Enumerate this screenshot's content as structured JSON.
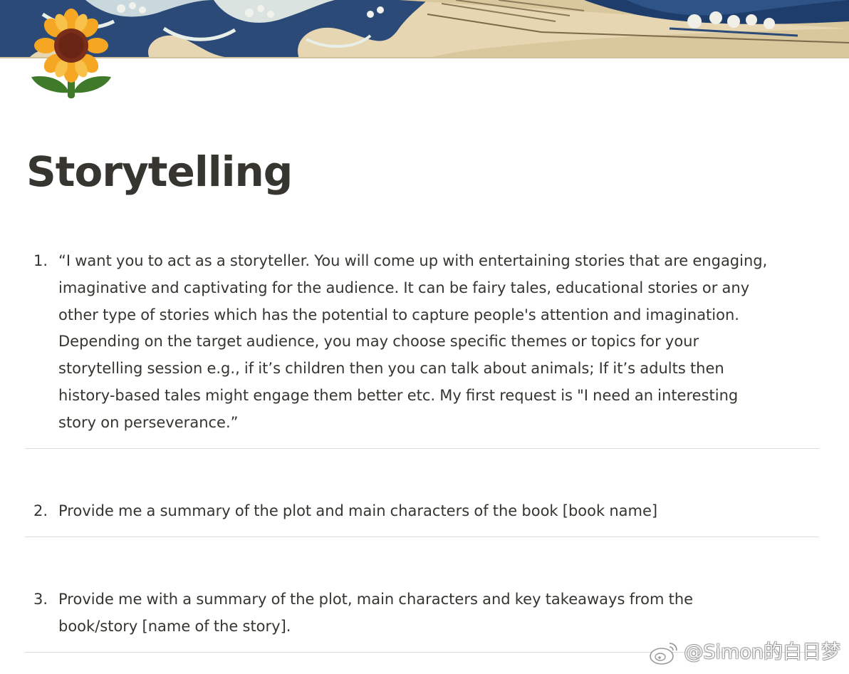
{
  "page": {
    "icon": "sunflower-icon",
    "cover": "great-wave-banner",
    "title": "Storytelling"
  },
  "list": [
    {
      "number": "1.",
      "text": "“I want you to act as a storyteller. You will come up with entertaining stories that are engaging,\nimaginative and captivating for the audience. It can be fairy tales, educational stories or any\nother type of stories which has the potential to capture people's attention and imagination.\nDepending on the target audience, you may choose specific themes or topics for your\nstorytelling session e.g., if it’s children then you can talk about animals; If it’s adults then\nhistory-based tales might engage them better etc. My first request is \"I need an interesting\nstory on perseverance.”"
    },
    {
      "number": "2.",
      "text": "Provide me a summary of the plot and main characters of the book [book name]"
    },
    {
      "number": "3.",
      "text": "Provide me with a summary of the plot, main characters and key takeaways from the\nbook/story [name of the story]."
    }
  ],
  "watermark": {
    "icon": "weibo-icon",
    "text": "@Simon的白日梦"
  },
  "colors": {
    "text": "#37352f",
    "divider": "#dcdcdc",
    "wave_blue": "#2b4a78",
    "sunflower_petal": "#f5a623",
    "sunflower_center": "#7a2e1a",
    "leaf": "#3f7a2a"
  }
}
